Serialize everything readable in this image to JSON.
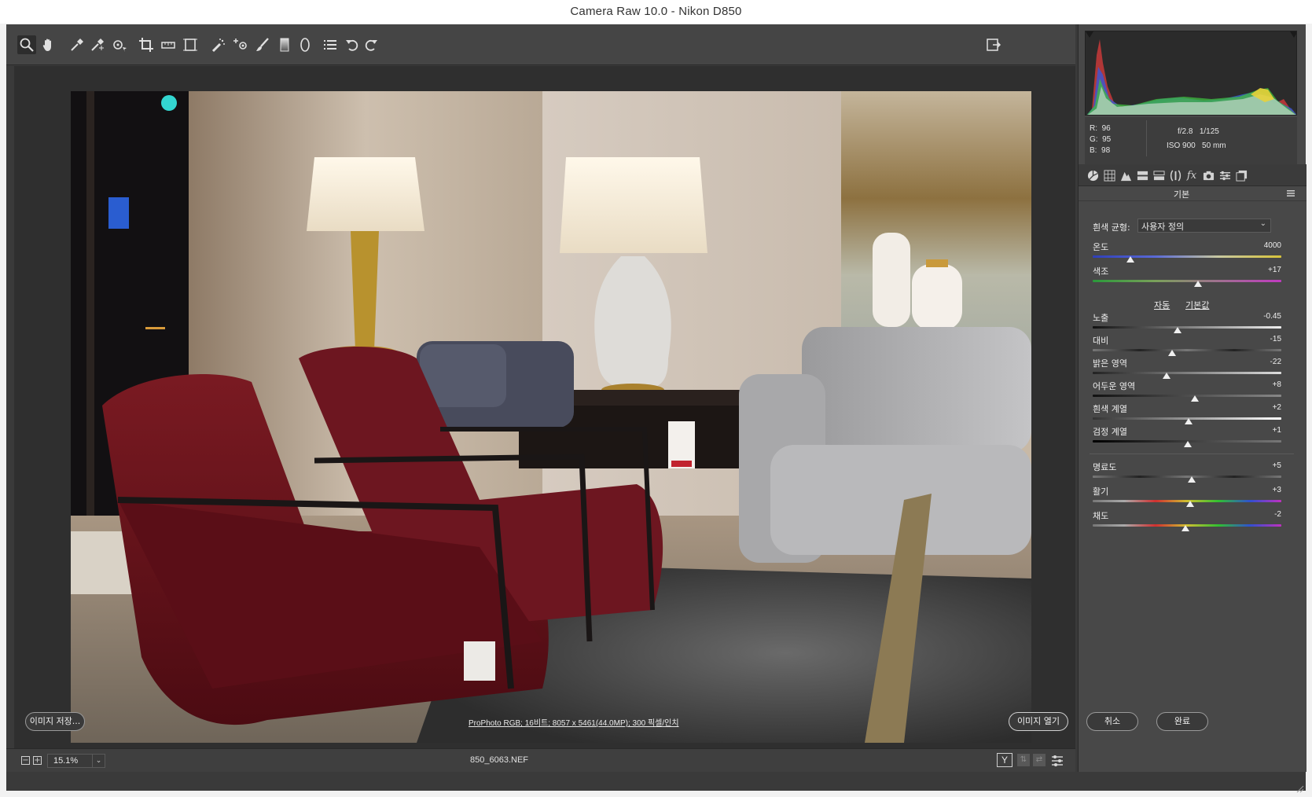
{
  "window": {
    "title": "Camera Raw 10.0  -  Nikon D850"
  },
  "toolbar": {
    "tools": [
      "zoom-icon",
      "hand-icon",
      "white-balance-icon",
      "color-sampler-icon",
      "target-adjust-icon",
      "crop-icon",
      "straighten-icon",
      "transform-icon",
      "spot-removal-icon",
      "red-eye-icon",
      "adjustment-brush-icon",
      "graduated-filter-icon",
      "radial-filter-icon",
      "preferences-icon",
      "rotate-ccw-icon",
      "rotate-cw-icon"
    ],
    "fullscreen_icon": "fullscreen-icon"
  },
  "preview": {
    "zoom": "15.1%",
    "filename": "850_6063.NEF",
    "before_after_label": "Y"
  },
  "readout": {
    "r_label": "R:",
    "r_value": "96",
    "g_label": "G:",
    "g_value": "95",
    "b_label": "B:",
    "b_value": "98",
    "aperture": "f/2.8",
    "shutter": "1/125",
    "iso": "ISO 900",
    "focal": "50 mm"
  },
  "panel": {
    "title": "기본",
    "wb_label": "흰색 균형:",
    "wb_value": "사용자 정의",
    "auto": "자동",
    "default": "기본값",
    "sliders": [
      {
        "label": "온도",
        "value": "4000",
        "pos": 0.2
      },
      {
        "label": "색조",
        "value": "+17",
        "pos": 0.56
      },
      {
        "label": "노출",
        "value": "-0.45",
        "pos": 0.45
      },
      {
        "label": "대비",
        "value": "-15",
        "pos": 0.42
      },
      {
        "label": "밝은 영역",
        "value": "-22",
        "pos": 0.39
      },
      {
        "label": "어두운 영역",
        "value": "+8",
        "pos": 0.54
      },
      {
        "label": "흰색 계열",
        "value": "+2",
        "pos": 0.51
      },
      {
        "label": "검정 계열",
        "value": "+1",
        "pos": 0.505
      },
      {
        "label": "명료도",
        "value": "+5",
        "pos": 0.525
      },
      {
        "label": "활기",
        "value": "+3",
        "pos": 0.515
      },
      {
        "label": "채도",
        "value": "-2",
        "pos": 0.49
      }
    ]
  },
  "bottom": {
    "save_image": "이미지 저장...",
    "workflow": "ProPhoto RGB; 16비트; 8057 x 5461(44.0MP); 300 픽셀/인치",
    "open_image": "이미지 열기",
    "cancel": "취소",
    "done": "완료"
  }
}
